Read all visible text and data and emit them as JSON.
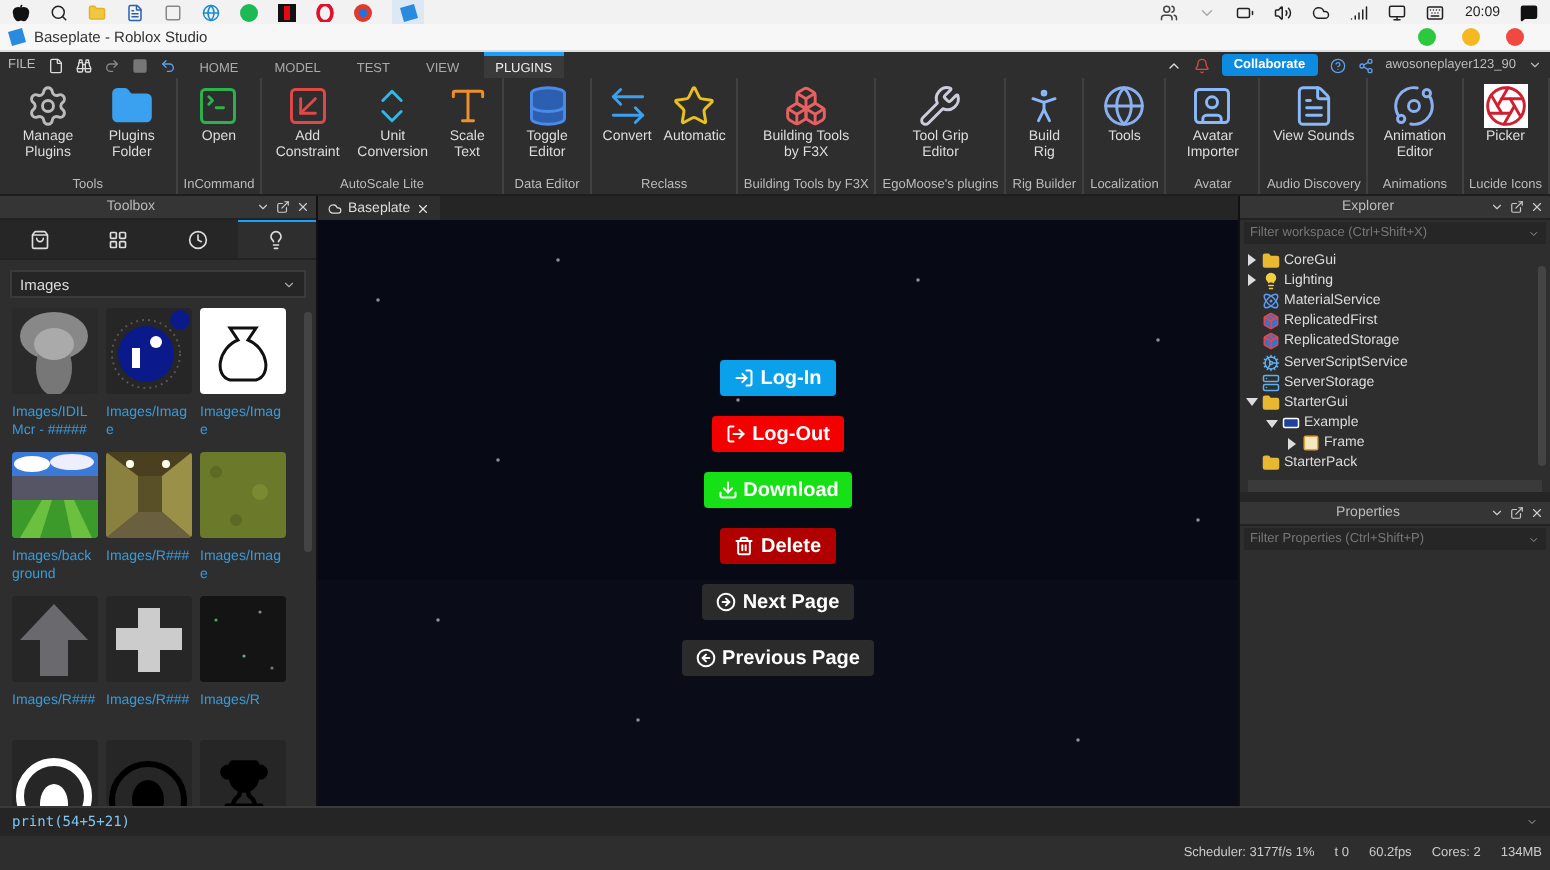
{
  "os_bar": {
    "clock": "20:09"
  },
  "window": {
    "title": "Baseplate - Roblox Studio"
  },
  "menu": {
    "file": "FILE",
    "tabs": [
      {
        "label": "HOME",
        "selected": false
      },
      {
        "label": "MODEL",
        "selected": false
      },
      {
        "label": "TEST",
        "selected": false
      },
      {
        "label": "VIEW",
        "selected": false
      },
      {
        "label": "PLUGINS",
        "selected": true
      }
    ],
    "collaborate": "Collaborate",
    "user": "awosoneplayer123_90"
  },
  "ribbon": {
    "groups": [
      {
        "label": "Tools",
        "tools": [
          {
            "label": "Manage Plugins",
            "kind": "gear"
          },
          {
            "label": "Plugins Folder",
            "kind": "folder"
          }
        ]
      },
      {
        "label": "InCommand",
        "tools": [
          {
            "label": "Open",
            "kind": "terminal"
          }
        ]
      },
      {
        "label": "AutoScale Lite",
        "tools": [
          {
            "label": "Add Constraint",
            "kind": "constraint"
          },
          {
            "label": "Unit Conversion",
            "kind": "unit"
          },
          {
            "label": "Scale Text",
            "kind": "text"
          }
        ]
      },
      {
        "label": "Data Editor",
        "tools": [
          {
            "label": "Toggle Editor",
            "kind": "database"
          }
        ]
      },
      {
        "label": "Reclass",
        "tools": [
          {
            "label": "Convert",
            "kind": "convert"
          },
          {
            "label": "Automatic",
            "kind": "automatic"
          }
        ]
      },
      {
        "label": "Building Tools by F3X",
        "tools": [
          {
            "label": "Building Tools by F3X",
            "kind": "blocks"
          }
        ]
      },
      {
        "label": "EgoMoose's plugins",
        "tools": [
          {
            "label": "Tool Grip Editor",
            "kind": "wrench"
          }
        ]
      },
      {
        "label": "Rig Builder",
        "tools": [
          {
            "label": "Build Rig",
            "kind": "figure"
          }
        ]
      },
      {
        "label": "Localization",
        "tools": [
          {
            "label": "Tools",
            "kind": "globe"
          }
        ]
      },
      {
        "label": "Avatar",
        "tools": [
          {
            "label": "Avatar Importer",
            "kind": "avatar"
          }
        ]
      },
      {
        "label": "Audio Discovery",
        "tools": [
          {
            "label": "View Sounds",
            "kind": "document"
          }
        ]
      },
      {
        "label": "Animations",
        "tools": [
          {
            "label": "Animation Editor",
            "kind": "animation"
          }
        ]
      },
      {
        "label": "Lucide Icons",
        "tools": [
          {
            "label": "Picker",
            "kind": "swirl"
          }
        ]
      }
    ]
  },
  "toolbox": {
    "title": "Toolbox",
    "tabs": [
      {
        "kind": "bag",
        "selected": false
      },
      {
        "kind": "grid",
        "selected": false
      },
      {
        "kind": "clock",
        "selected": false
      },
      {
        "kind": "bulb",
        "selected": true
      }
    ],
    "category": "Images",
    "assets": [
      {
        "label": "Images/IDILMcr - #####",
        "kind": "picture"
      },
      {
        "label": "Images/Image",
        "kind": "logo"
      },
      {
        "label": "Images/Image",
        "kind": "money"
      },
      {
        "label": "Images/background",
        "kind": "picture"
      },
      {
        "label": "Images/R###",
        "kind": "picture"
      },
      {
        "label": "Images/Image",
        "kind": "picture"
      },
      {
        "label": "Images/R###",
        "kind": "arrow"
      },
      {
        "label": "Images/R###",
        "kind": "plus"
      },
      {
        "label": "Images/R",
        "kind": "picture"
      },
      {
        "kind": "ring"
      },
      {
        "kind": "dome"
      },
      {
        "kind": "trophy"
      }
    ]
  },
  "viewport": {
    "tab": "Baseplate",
    "buttons": [
      {
        "label": "Log-In",
        "kind": "login",
        "color": "#0aa0ea"
      },
      {
        "label": "Log-Out",
        "kind": "logout",
        "color": "#f50000"
      },
      {
        "label": "Download",
        "kind": "download",
        "color": "#16e016"
      },
      {
        "label": "Delete",
        "kind": "delete",
        "color": "#b00000"
      },
      {
        "label": "Next Page",
        "kind": "next",
        "color": "#2b2b2b"
      },
      {
        "label": "Previous Page",
        "kind": "previous",
        "color": "#2b2b2b"
      }
    ]
  },
  "explorer": {
    "title": "Explorer",
    "filter_placeholder": "Filter workspace (Ctrl+Shift+X)",
    "items": [
      {
        "label": "CoreGui",
        "kind": "folder",
        "expanded": false
      },
      {
        "label": "Lighting",
        "kind": "bulb",
        "expanded": false
      },
      {
        "label": "MaterialService",
        "kind": "material"
      },
      {
        "label": "ReplicatedFirst",
        "kind": "replicated"
      },
      {
        "label": "ReplicatedStorage",
        "kind": "replicated"
      },
      {
        "label": "ServerScriptService",
        "kind": "server-script"
      },
      {
        "label": "ServerStorage",
        "kind": "server-storage"
      },
      {
        "label": "StarterGui",
        "kind": "folder",
        "expanded": true,
        "children": [
          {
            "label": "Example",
            "kind": "gui",
            "expanded": true,
            "children": [
              {
                "label": "Frame",
                "kind": "frame",
                "expanded": false
              }
            ]
          }
        ]
      },
      {
        "label": "StarterPack",
        "kind": "folder"
      }
    ]
  },
  "properties": {
    "title": "Properties",
    "filter_placeholder": "Filter Properties (Ctrl+Shift+P)"
  },
  "command_bar": {
    "value": "print(54+5+21)"
  },
  "status_bar": [
    "Scheduler: 3177f/s 1%",
    "t 0",
    "60.2fps",
    "Cores: 2",
    "134MB"
  ]
}
